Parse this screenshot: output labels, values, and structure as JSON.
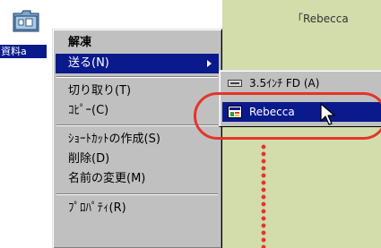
{
  "desktop": {
    "folder_label": "資料a",
    "caption": "「Rebecca"
  },
  "context_menu": {
    "items": [
      {
        "label": "解凍",
        "bold": true
      },
      {
        "label": "送る(N)",
        "selected": true,
        "submenu": true
      },
      {
        "label": "切り取り(T)"
      },
      {
        "label": "ｺﾋﾟｰ(C)"
      },
      {
        "label": "ｼｮｰﾄｶｯﾄの作成(S)"
      },
      {
        "label": "削除(D)"
      },
      {
        "label": "名前の変更(M)"
      },
      {
        "label": "ﾌﾟﾛﾊﾟﾃｨ(R)"
      }
    ]
  },
  "send_to_menu": {
    "items": [
      {
        "label": "3.5ｲﾝﾁ FD (A)",
        "icon": "floppy-drive-icon"
      },
      {
        "label": "Rebecca",
        "icon": "app-shortcut-icon",
        "selected": true
      }
    ]
  },
  "colors": {
    "highlight": "#0a1a8c",
    "annotation_red": "#e2362b",
    "background": "#d3dcab"
  }
}
